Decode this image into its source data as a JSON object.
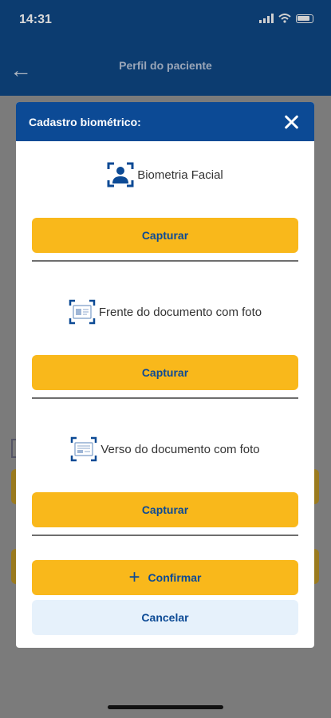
{
  "status_bar": {
    "time": "14:31"
  },
  "background": {
    "page_title": "Perfil do paciente"
  },
  "modal": {
    "title": "Cadastro biométrico:",
    "sections": [
      {
        "label": "Biometria Facial",
        "icon": "face-scan-icon",
        "button": "Capturar"
      },
      {
        "label": "Frente do documento com foto",
        "icon": "document-front-icon",
        "button": "Capturar"
      },
      {
        "label": "Verso do documento com foto",
        "icon": "document-back-icon",
        "button": "Capturar"
      }
    ],
    "confirm_label": "Confirmar",
    "cancel_label": "Cancelar"
  },
  "colors": {
    "primary": "#0c4a95",
    "accent": "#f9b81b",
    "light": "#e6f1fb"
  }
}
